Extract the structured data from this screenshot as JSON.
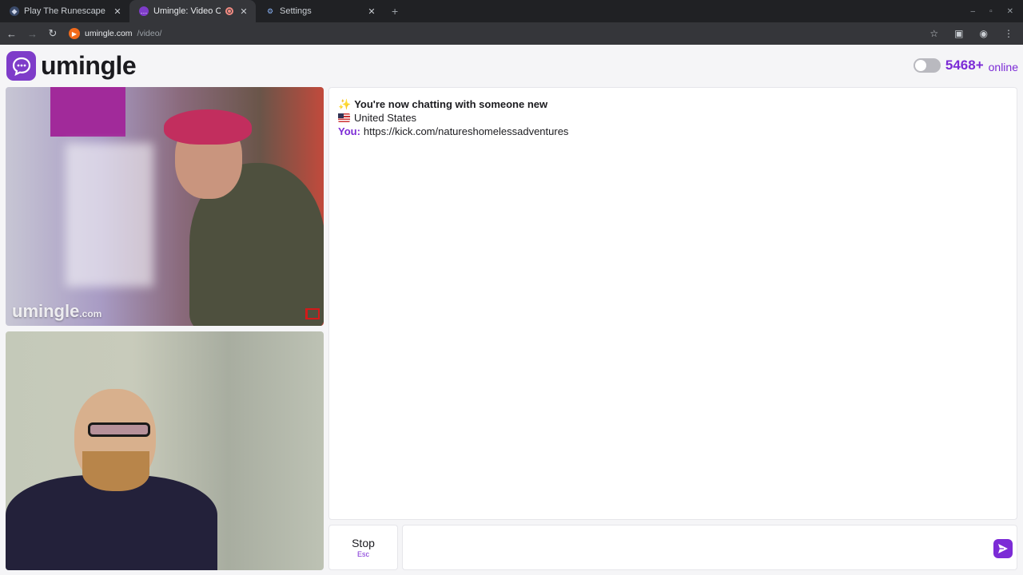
{
  "browser": {
    "tabs": [
      {
        "title": "Play The Runescape Cra",
        "favicon": "runescape-favicon",
        "active": false
      },
      {
        "title": "Umingle: Video Chat",
        "favicon": "umingle-favicon",
        "active": true,
        "recording": true
      },
      {
        "title": "Settings",
        "favicon": "gear-icon",
        "active": false
      }
    ],
    "new_tab": "+",
    "url_domain": "umingle.com",
    "url_path": "/video/",
    "window_controls": {
      "minimize": "–",
      "maximize": "▫",
      "close": "✕"
    }
  },
  "header": {
    "logo_text": "umingle",
    "online_count": "5468+",
    "online_label": "online",
    "accent": "#7c2bd6"
  },
  "videos": {
    "remote_watermark": "umingle",
    "remote_watermark_suffix": ".com"
  },
  "chat": {
    "system_emoji": "✨",
    "system_message": "You're now chatting with someone new",
    "country": "United States",
    "you_label": "You:",
    "you_message": "https://kick.com/natureshomelessadventures"
  },
  "controls": {
    "stop_label": "Stop",
    "stop_hint": "Esc",
    "message_placeholder": ""
  }
}
